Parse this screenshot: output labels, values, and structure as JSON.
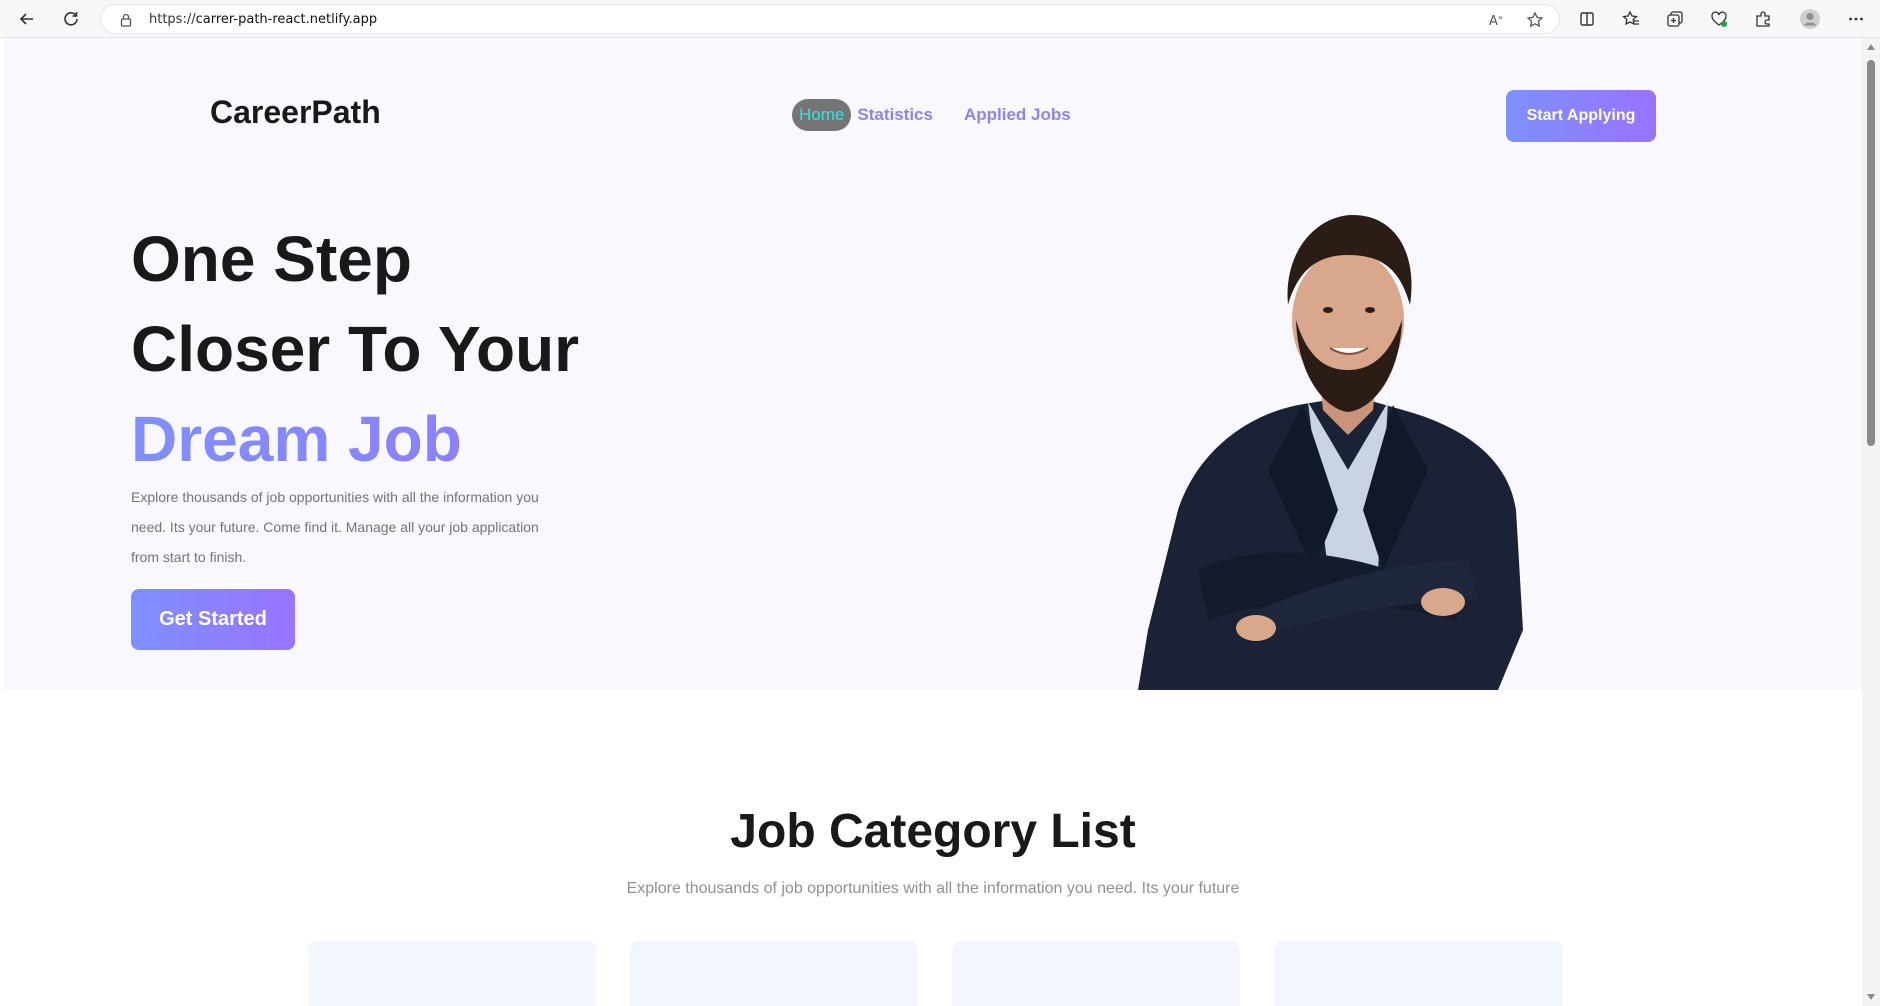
{
  "browser": {
    "url_prefix": "https://",
    "url_host": "carrer-path-react.netlify.app"
  },
  "nav": {
    "brand": "CareerPath",
    "links": [
      {
        "label": "Home",
        "active": true
      },
      {
        "label": "Statistics",
        "active": false
      },
      {
        "label": "Applied Jobs",
        "active": false
      }
    ],
    "cta": "Start Applying"
  },
  "hero": {
    "line1": "One Step",
    "line2": "Closer To Your",
    "line3": "Dream Job",
    "description": "Explore thousands of job opportunities with all the information you need. Its your future. Come find it. Manage all your job application from start to finish.",
    "button": "Get Started"
  },
  "categories": {
    "title": "Job Category List",
    "subtitle": "Explore thousands of job opportunities with all the information you need. Its your future"
  },
  "colors": {
    "accent_start": "#7e90fe",
    "accent_end": "#9873ff",
    "active_link_bg": "#757575",
    "active_link_text": "#2ee6df",
    "hero_bg": "#f9f8ff",
    "card_bg": "#f2f7ff"
  }
}
